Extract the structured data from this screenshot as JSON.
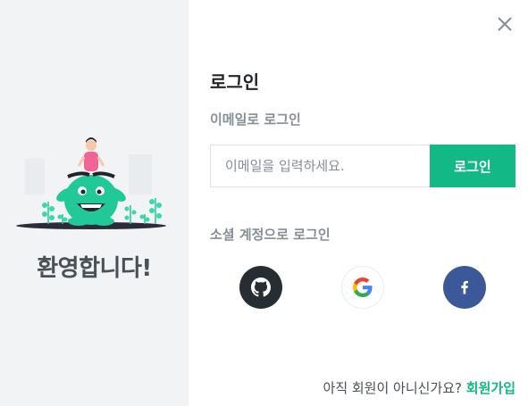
{
  "left_panel": {
    "welcome_text": "환영합니다!",
    "background_color": "#f1f3f5"
  },
  "login": {
    "title": "로그인",
    "email_section_label": "이메일로 로그인",
    "email_placeholder": "이메일을 입력하세요.",
    "email_value": "",
    "login_button_label": "로그인",
    "social_section_label": "소셜 계정으로 로그인",
    "social_buttons": [
      {
        "name": "github",
        "icon": "github-icon",
        "color": "#272e33"
      },
      {
        "name": "google",
        "icon": "google-icon",
        "color": "#ffffff"
      },
      {
        "name": "facebook",
        "icon": "facebook-icon",
        "color": "#3b5998"
      }
    ],
    "close_icon": "close-icon"
  },
  "footer": {
    "prompt_text": "아직 회원이 아니신가요?",
    "signup_link": "회원가입"
  },
  "colors": {
    "accent": "#12b886",
    "muted_text": "#868e96"
  }
}
